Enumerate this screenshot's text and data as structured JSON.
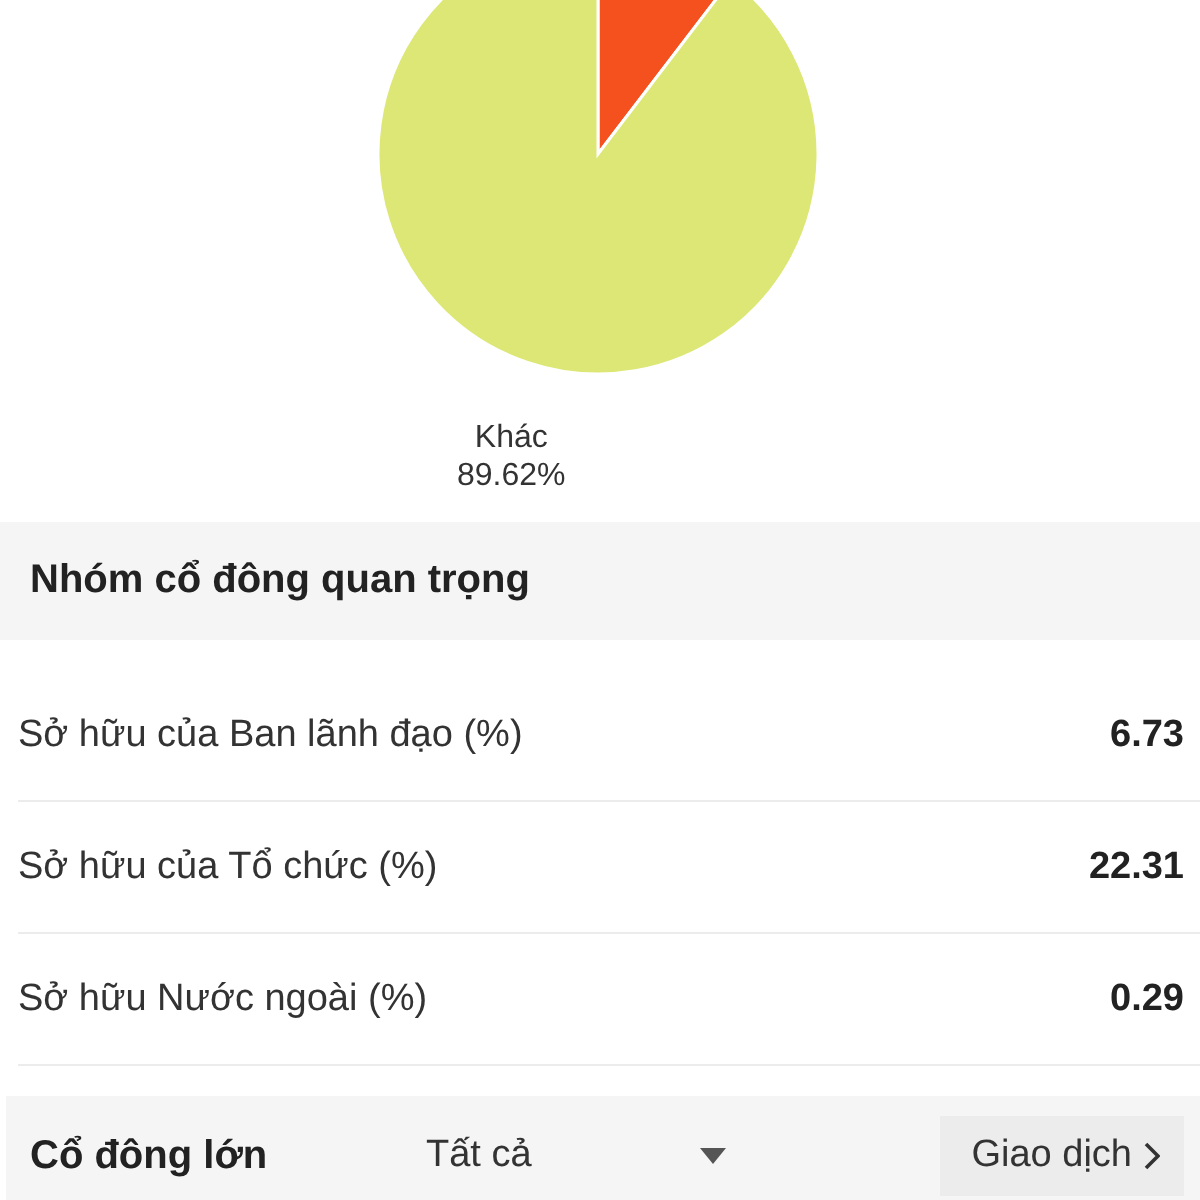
{
  "ownership_chart": {
    "chart_data": {
      "type": "pie",
      "categories": [
        null,
        "Khác"
      ],
      "values": [
        10.38,
        89.62
      ],
      "colors": [
        "#f4511e",
        "#dce775"
      ],
      "value_labels": [
        null,
        "89.62%"
      ]
    }
  },
  "key_groups": {
    "title": "Nhóm cổ đông quan trọng",
    "rows": [
      {
        "label": "Sở hữu của Ban lãnh đạo (%)",
        "value": "6.73"
      },
      {
        "label": "Sở hữu của Tổ chức (%)",
        "value": "22.31"
      },
      {
        "label": "Sở hữu Nước ngoài (%)",
        "value": "0.29"
      }
    ]
  },
  "major_shareholders": {
    "title": "Cổ đông lớn",
    "filter": "Tất cả",
    "link": "Giao dịch"
  }
}
